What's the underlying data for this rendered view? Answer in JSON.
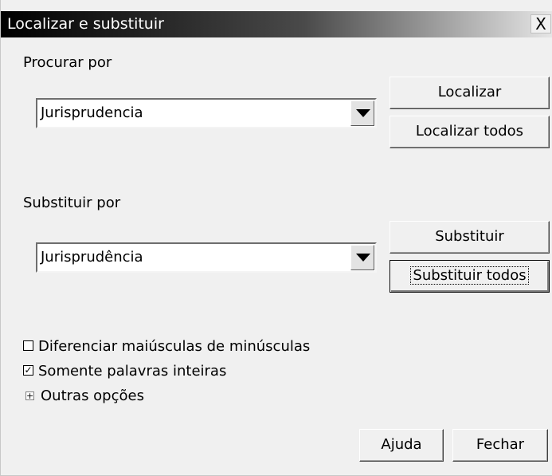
{
  "dialog": {
    "title": "Localizar e substituir",
    "close_glyph": "X"
  },
  "find": {
    "label": "Procurar por",
    "value": "Jurisprudencia",
    "find_button": "Localizar",
    "find_all_button": "Localizar todos"
  },
  "replace": {
    "label": "Substituir por",
    "value": "Jurisprudência",
    "replace_button": "Substituir",
    "replace_all_button": "Substituir todos"
  },
  "options": {
    "match_case": {
      "label": "Diferenciar maiúsculas de minúsculas",
      "checked": false
    },
    "whole_words": {
      "label": "Somente palavras inteiras",
      "checked": true
    },
    "more_options": {
      "label": "Outras opções",
      "expander": "+"
    }
  },
  "footer": {
    "help_button": "Ajuda",
    "close_button": "Fechar"
  },
  "icons": [
    "close-icon",
    "dropdown-arrow-icon",
    "checkbox-icon",
    "expand-icon"
  ]
}
